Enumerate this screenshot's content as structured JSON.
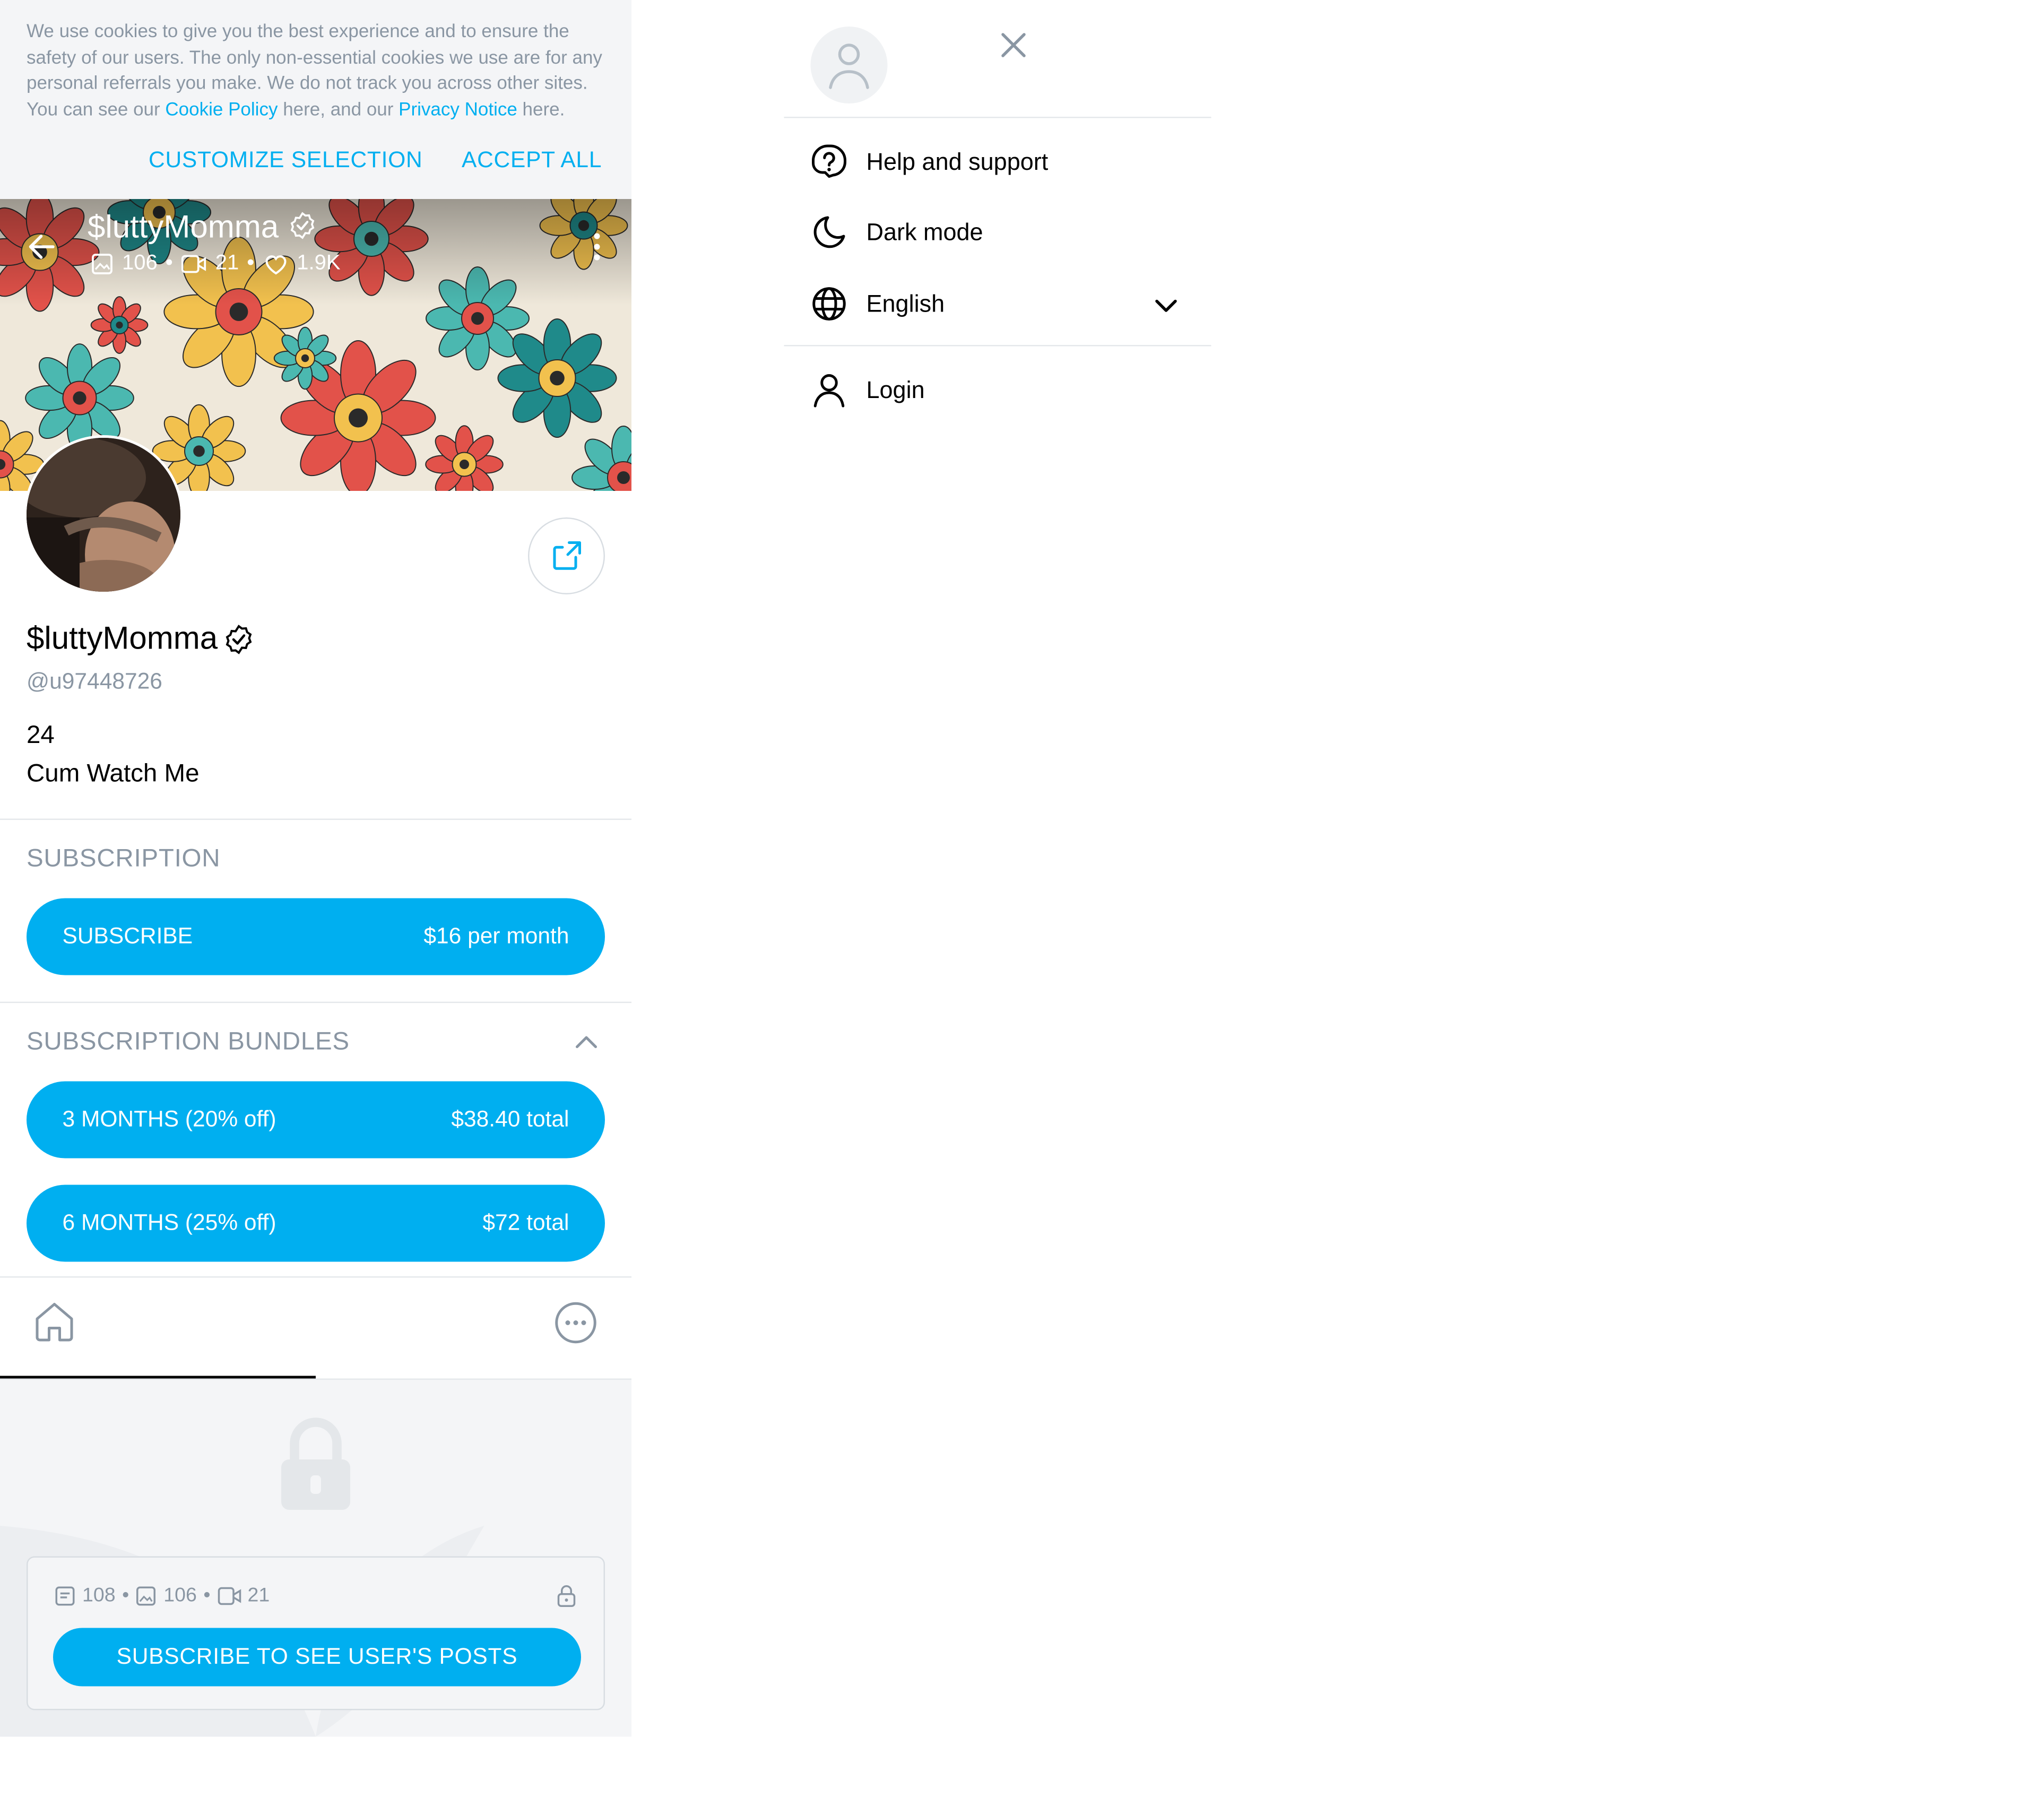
{
  "cookie_banner": {
    "text_before": "We use cookies to give you the best experience and to ensure the safety of our users. The only non-essential cookies we use are for any personal referrals you make. We do not track you across other sites. You can see our ",
    "cookie_policy_link": "Cookie Policy",
    "text_middle": " here, and our ",
    "privacy_notice_link": "Privacy Notice",
    "text_after": " here.",
    "customize_label": "CUSTOMIZE SELECTION",
    "accept_label": "ACCEPT ALL"
  },
  "cover": {
    "name": "$luttyMomma",
    "photos_count": "106",
    "videos_count": "21",
    "likes_count": "1.9K",
    "separator": "•"
  },
  "profile": {
    "name": "$luttyMomma",
    "handle": "@u97448726",
    "bio_line1": "24⁣⁣",
    "bio_line2": "Cum Watch Me⁣"
  },
  "subscription": {
    "section_title": "SUBSCRIPTION",
    "subscribe_label": "SUBSCRIBE",
    "subscribe_price": "$16 per month"
  },
  "bundles": {
    "section_title": "SUBSCRIPTION BUNDLES",
    "items": [
      {
        "label": "3 MONTHS (20% off)",
        "price": "$38.40 total"
      },
      {
        "label": "6 MONTHS (25% off)",
        "price": "$72 total"
      }
    ]
  },
  "locked": {
    "posts_count": "108",
    "photos_count": "106",
    "videos_count": "21",
    "separator": "•",
    "button_label": "SUBSCRIBE TO SEE USER'S POSTS"
  },
  "menu": {
    "help_label": "Help and support",
    "dark_mode_label": "Dark mode",
    "language_label": "English",
    "login_label": "Login"
  },
  "colors": {
    "accent": "#00aff0",
    "muted_text": "#8a96a3",
    "background_gray": "#f4f5f7"
  },
  "icons": {
    "cover": [
      "back-arrow-icon",
      "photo-icon",
      "video-icon",
      "heart-icon",
      "more-vertical-icon",
      "verified-badge-icon"
    ],
    "profile": [
      "share-icon",
      "verified-badge-icon",
      "chevron-up-icon",
      "home-icon",
      "more-horizontal-icon",
      "lock-icon",
      "post-icon"
    ],
    "menu": [
      "user-avatar-icon",
      "close-icon",
      "help-icon",
      "moon-icon",
      "globe-icon",
      "chevron-down-icon",
      "user-icon"
    ]
  }
}
